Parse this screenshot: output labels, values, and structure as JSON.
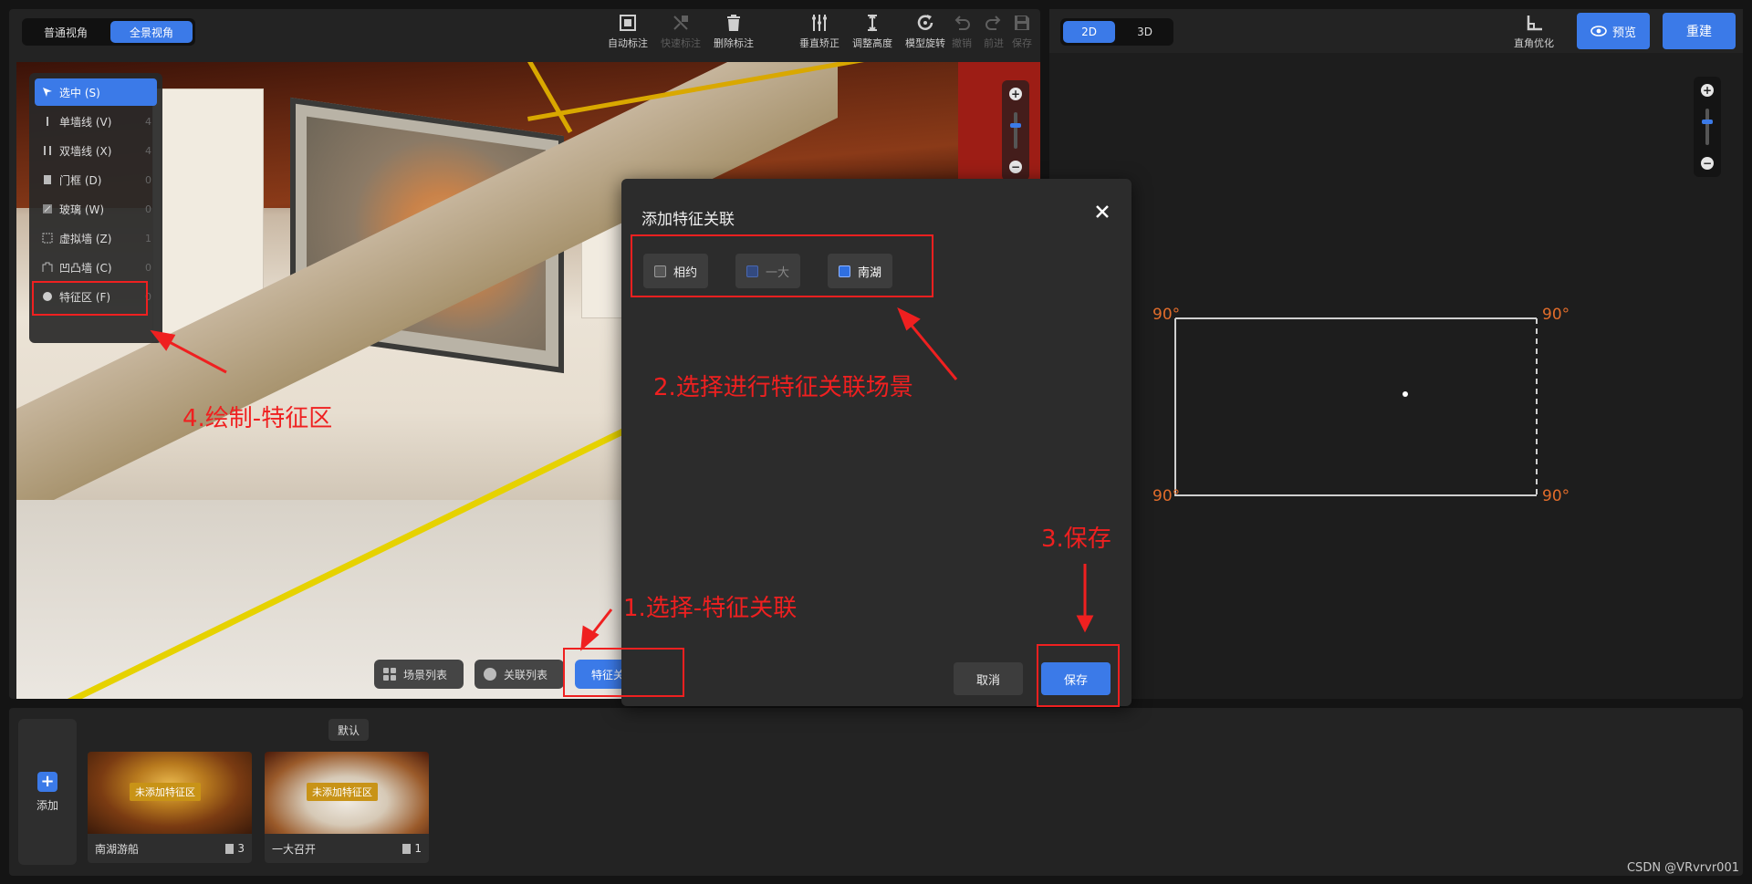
{
  "view_toggle": {
    "normal": "普通视角",
    "panorama": "全景视角",
    "active": "panorama"
  },
  "toolbar": [
    {
      "id": "auto-label",
      "label": "自动标注",
      "enabled": true,
      "icon": "auto-label-icon"
    },
    {
      "id": "quick-label",
      "label": "快速标注",
      "enabled": false,
      "icon": "quick-label-icon"
    },
    {
      "id": "delete-label",
      "label": "删除标注",
      "enabled": true,
      "icon": "trash-icon"
    },
    {
      "id": "vertical-correct",
      "label": "垂直矫正",
      "enabled": true,
      "icon": "vertical-lines-icon"
    },
    {
      "id": "adjust-height",
      "label": "调整高度",
      "enabled": true,
      "icon": "height-icon"
    },
    {
      "id": "model-rotate",
      "label": "模型旋转",
      "enabled": true,
      "icon": "rotate-icon"
    },
    {
      "id": "undo",
      "label": "撤销",
      "enabled": false,
      "icon": "undo-icon"
    },
    {
      "id": "redo",
      "label": "前进",
      "enabled": false,
      "icon": "redo-icon"
    },
    {
      "id": "save",
      "label": "保存",
      "enabled": false,
      "icon": "save-icon"
    }
  ],
  "tool_menu": [
    {
      "label": "选中 (S)",
      "count": "",
      "active": true,
      "icon": "cursor-icon"
    },
    {
      "label": "单墙线 (V)",
      "count": "4",
      "active": false,
      "icon": "single-wall-icon"
    },
    {
      "label": "双墙线 (X)",
      "count": "4",
      "active": false,
      "icon": "double-wall-icon"
    },
    {
      "label": "门框 (D)",
      "count": "0",
      "active": false,
      "icon": "door-icon"
    },
    {
      "label": "玻璃 (W)",
      "count": "0",
      "active": false,
      "icon": "glass-icon"
    },
    {
      "label": "虚拟墙 (Z)",
      "count": "1",
      "active": false,
      "icon": "virtual-wall-icon"
    },
    {
      "label": "凹凸墙 (C)",
      "count": "0",
      "active": false,
      "icon": "bump-wall-icon"
    },
    {
      "label": "特征区 (F)",
      "count": "0",
      "active": false,
      "icon": "feature-area-icon"
    }
  ],
  "viewport_tabs": [
    {
      "label": "场景列表",
      "active": false
    },
    {
      "label": "关联列表",
      "active": false
    },
    {
      "label": "特征关联",
      "active": true
    }
  ],
  "right_panel": {
    "dim_2d": "2D",
    "dim_3d": "3D",
    "active_dim": "2D",
    "angle_opt_label": "直角优化",
    "preview_label": "预览",
    "rebuild_label": "重建",
    "angles": [
      "90°",
      "90°",
      "90°",
      "90°"
    ]
  },
  "bottom": {
    "add_label": "添加",
    "default_tag": "默认",
    "scenes": [
      {
        "name": "南湖游船",
        "count": "3",
        "badge": "未添加特征区"
      },
      {
        "name": "一大召开",
        "count": "1",
        "badge": "未添加特征区"
      }
    ]
  },
  "modal": {
    "title": "添加特征关联",
    "options": [
      {
        "label": "相约",
        "state": "normal"
      },
      {
        "label": "一大",
        "state": "disabled"
      },
      {
        "label": "南湖",
        "state": "checked"
      }
    ],
    "cancel": "取消",
    "save": "保存"
  },
  "annotations": {
    "step1": "1.选择-特征关联",
    "step2": "2.选择进行特征关联场景",
    "step3": "3.保存",
    "step4": "4.绘制-特征区"
  },
  "watermark": "CSDN @VRvrvr001",
  "colors": {
    "accent": "#3b7ae8",
    "annotation": "#ef2020",
    "angle": "#e26d2b"
  }
}
